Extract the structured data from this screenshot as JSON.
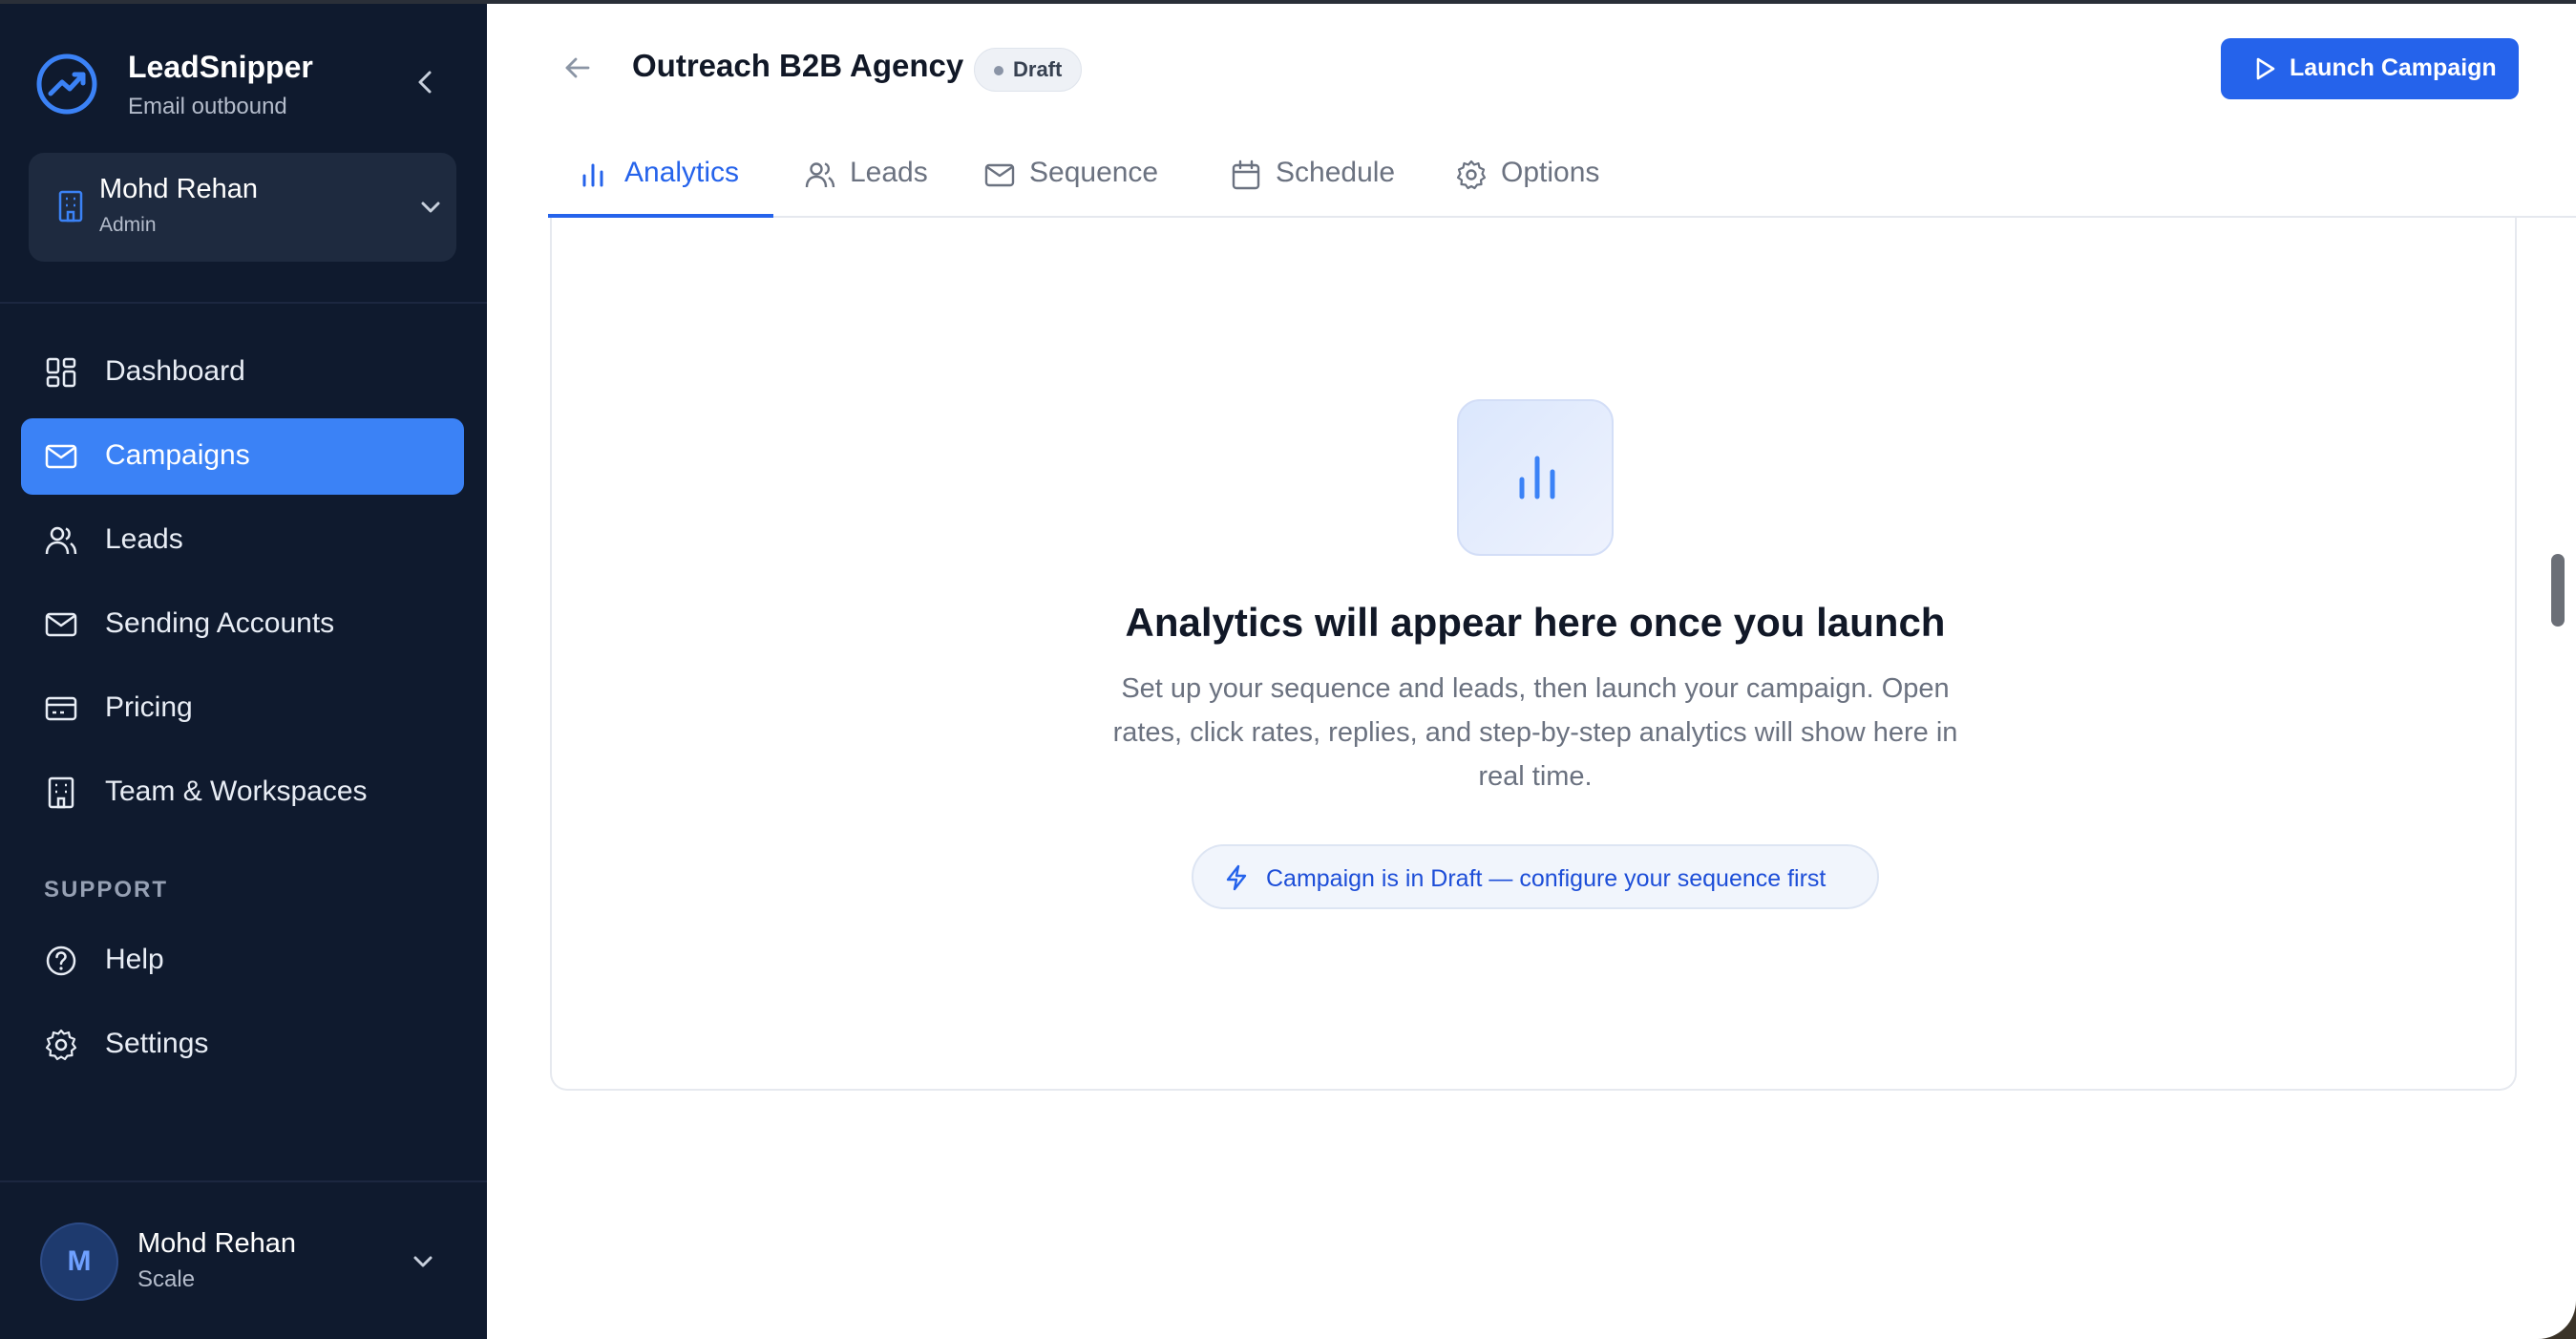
{
  "brand": {
    "name": "LeadSnipper",
    "subtitle": "Email outbound"
  },
  "workspace": {
    "name": "Mohd Rehan",
    "role": "Admin"
  },
  "nav": {
    "items": [
      {
        "label": "Dashboard",
        "icon": "dashboard-icon"
      },
      {
        "label": "Campaigns",
        "icon": "mail-icon",
        "active": true
      },
      {
        "label": "Leads",
        "icon": "users-icon"
      },
      {
        "label": "Sending Accounts",
        "icon": "mail-icon"
      },
      {
        "label": "Pricing",
        "icon": "credit-card-icon"
      },
      {
        "label": "Team & Workspaces",
        "icon": "building-icon"
      }
    ],
    "support_heading": "SUPPORT",
    "support_items": [
      {
        "label": "Help",
        "icon": "help-circle-icon"
      },
      {
        "label": "Settings",
        "icon": "gear-icon"
      }
    ]
  },
  "user": {
    "initial": "M",
    "name": "Mohd Rehan",
    "plan": "Scale"
  },
  "header": {
    "title": "Outreach B2B Agency",
    "status": "Draft",
    "launch_label": "Launch Campaign"
  },
  "tabs": [
    {
      "label": "Analytics",
      "active": true
    },
    {
      "label": "Leads"
    },
    {
      "label": "Sequence"
    },
    {
      "label": "Schedule"
    },
    {
      "label": "Options"
    }
  ],
  "empty_state": {
    "title": "Analytics will appear here once you launch",
    "description": "Set up your sequence and leads, then launch your campaign. Open rates, click rates, replies, and step-by-step analytics will show here in real time.",
    "notice": "Campaign is in Draft — configure your sequence first"
  },
  "colors": {
    "accent": "#2563eb",
    "sidebar_bg": "#0f1a2e",
    "active_nav": "#3b82f6"
  }
}
